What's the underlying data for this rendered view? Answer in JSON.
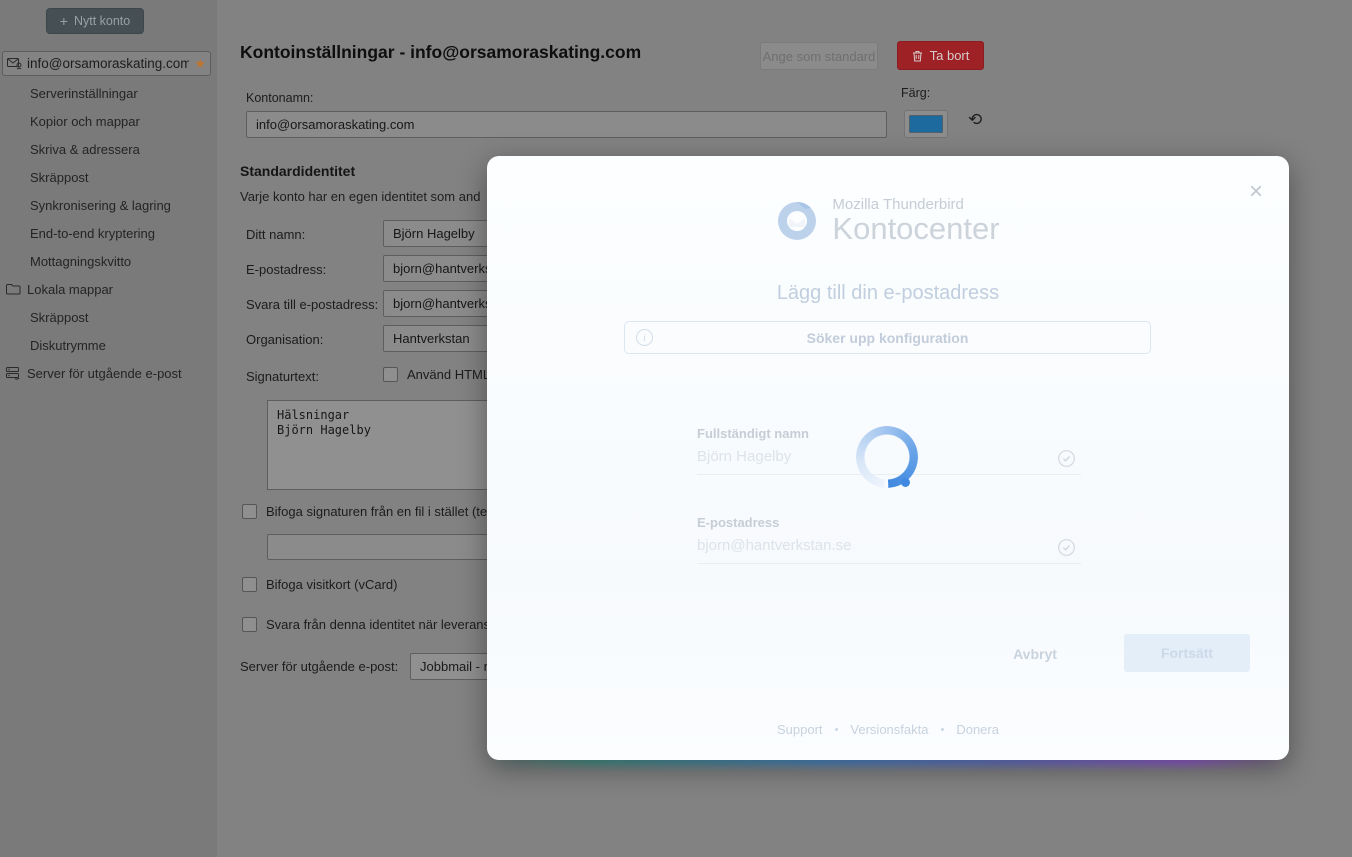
{
  "sidebar": {
    "new_account_button": "Nytt konto",
    "plus_glyph": "+",
    "account": {
      "label": "info@orsamoraskating.com",
      "star": "★"
    },
    "account_items": [
      "Serverinställningar",
      "Kopior och mappar",
      "Skriva & adressera",
      "Skräppost",
      "Synkronisering & lagring",
      "End-to-end kryptering",
      "Mottagningskvitto"
    ],
    "local_folders": {
      "label": "Lokala mappar",
      "items": [
        "Skräppost",
        "Diskutrymme"
      ]
    },
    "outgoing_server": "Server för utgående e-post"
  },
  "main": {
    "title": "Kontoinställningar - info@orsamoraskating.com",
    "set_default_button": "Ange som standard",
    "delete_button": "Ta bort",
    "account_name": {
      "label": "Kontonamn:",
      "value": "info@orsamoraskating.com"
    },
    "color": {
      "label": "Färg:",
      "value": "#1d6a9e",
      "reset_glyph": "⟲"
    },
    "identity": {
      "heading": "Standardidentitet",
      "description": "Varje konto har en egen identitet som and",
      "fields": [
        {
          "label": "Ditt namn:",
          "value": "Björn Hagelby"
        },
        {
          "label": "E-postadress:",
          "value": "bjorn@hantverks"
        },
        {
          "label": "Svara till e-postadress:",
          "value": "bjorn@hantverks"
        },
        {
          "label": "Organisation:",
          "value": "Hantverkstan"
        }
      ],
      "signature_label": "Signaturtext:",
      "use_html_checkbox": "Använd HTML",
      "signature_text": "Hälsningar\nBjörn Hagelby",
      "attach_file_checkbox": "Bifoga signaturen från en fil i stället (te",
      "vcard_checkbox": "Bifoga visitkort (vCard)",
      "reply_identity_checkbox": "Svara från denna identitet när leverans",
      "outgoing_label": "Server för utgående e-post:",
      "outgoing_value": "Jobbmail - r"
    }
  },
  "modal": {
    "brand": "Mozilla Thunderbird",
    "title": "Kontocenter",
    "subtitle": "Lägg till din e-postadress",
    "status": "Söker upp konfiguration",
    "info_glyph": "i",
    "close_glyph": "×",
    "fields": [
      {
        "label": "Fullständigt namn",
        "value": "Björn Hagelby"
      },
      {
        "label": "E-postadress",
        "value": "bjorn@hantverkstan.se"
      }
    ],
    "cancel_button": "Avbryt",
    "continue_button": "Fortsätt",
    "separator": "•",
    "footer_links": [
      "Support",
      "Versionsfakta",
      "Donera"
    ]
  }
}
